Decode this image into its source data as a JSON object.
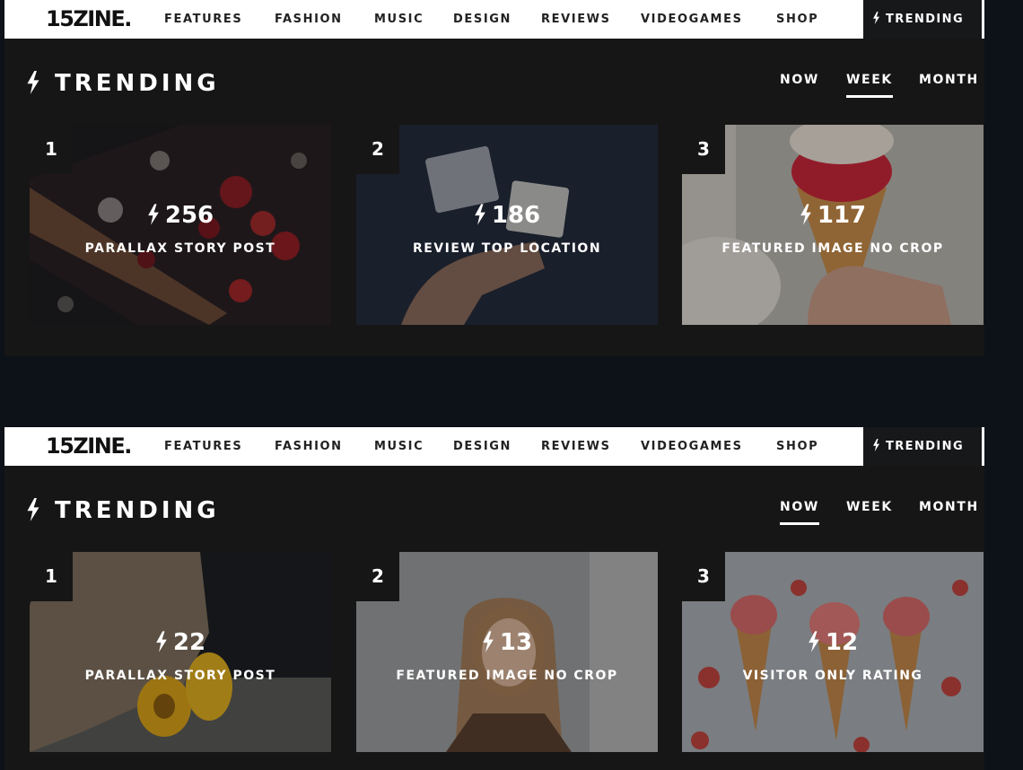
{
  "site": {
    "logo": "15ZINE.",
    "nav_items": [
      "FEATURES",
      "FASHION",
      "MUSIC",
      "DESIGN",
      "REVIEWS",
      "VIDEOGAMES",
      "SHOP"
    ],
    "trending_tab": "TRENDING"
  },
  "colors": {
    "bar": "#ffffff",
    "panel": "#161616",
    "page": "#0d1118",
    "text": "#ffffff"
  },
  "modules": [
    {
      "title": "TRENDING",
      "filters": [
        "NOW",
        "WEEK",
        "MONTH"
      ],
      "active_filter": "WEEK",
      "cards": [
        {
          "rank": "1",
          "count": "256",
          "title": "PARALLAX STORY POST",
          "image": "red-berries-flowers"
        },
        {
          "rank": "2",
          "count": "186",
          "title": "REVIEW TOP LOCATION",
          "image": "hand-holding-cards"
        },
        {
          "rank": "3",
          "count": "117",
          "title": "FEATURED IMAGE NO CROP",
          "image": "ice-cream-cone"
        }
      ]
    },
    {
      "title": "TRENDING",
      "filters": [
        "NOW",
        "WEEK",
        "MONTH"
      ],
      "active_filter": "NOW",
      "cards": [
        {
          "rank": "1",
          "count": "22",
          "title": "PARALLAX STORY POST",
          "image": "yellow-squash"
        },
        {
          "rank": "2",
          "count": "13",
          "title": "FEATURED IMAGE NO CROP",
          "image": "woman-portrait"
        },
        {
          "rank": "3",
          "count": "12",
          "title": "VISITOR ONLY RATING",
          "image": "ice-cream-cones"
        }
      ]
    }
  ]
}
